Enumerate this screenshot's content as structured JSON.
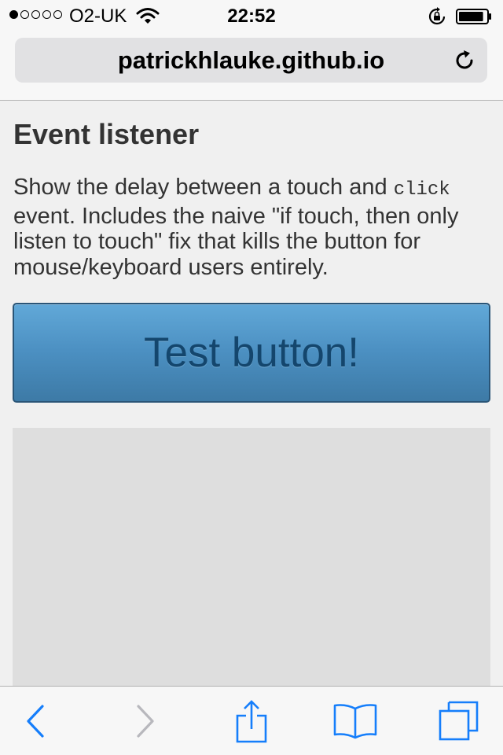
{
  "status_bar": {
    "carrier": "O2-UK",
    "time": "22:52",
    "signal_bars_filled": 1,
    "signal_bars_total": 5,
    "battery_level": 0.9
  },
  "browser": {
    "url": "patrickhlauke.github.io",
    "reload_icon": "reload-icon"
  },
  "page": {
    "title": "Event listener",
    "description_before": "Show the delay between a touch and ",
    "description_code": "click",
    "description_after": " event. Includes the naive \"if touch, then only listen to touch\" fix that kills the button for mouse/keyboard users entirely.",
    "button_label": "Test button!"
  },
  "toolbar": {
    "items": [
      {
        "name": "back-icon",
        "enabled": true
      },
      {
        "name": "forward-icon",
        "enabled": false
      },
      {
        "name": "share-icon",
        "enabled": true
      },
      {
        "name": "bookmarks-icon",
        "enabled": true
      },
      {
        "name": "tabs-icon",
        "enabled": true
      }
    ]
  },
  "colors": {
    "accent": "#157efb",
    "disabled": "#b8b8bd",
    "button_top": "#61a8d8",
    "button_bottom": "#3d7aa6",
    "button_text": "#14466d"
  }
}
